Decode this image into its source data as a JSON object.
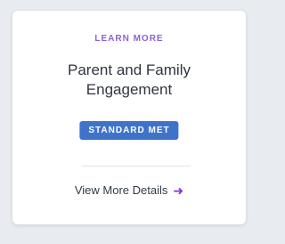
{
  "card": {
    "kicker": "LEARN MORE",
    "title": "Parent and Family Engagement",
    "badge": "STANDARD MET",
    "details_link": "View More Details",
    "arrow_icon": "arrow-right-icon"
  },
  "colors": {
    "kicker": "#8a63d2",
    "badge_bg": "#3f73c9",
    "arrow": "#8a2be2"
  }
}
